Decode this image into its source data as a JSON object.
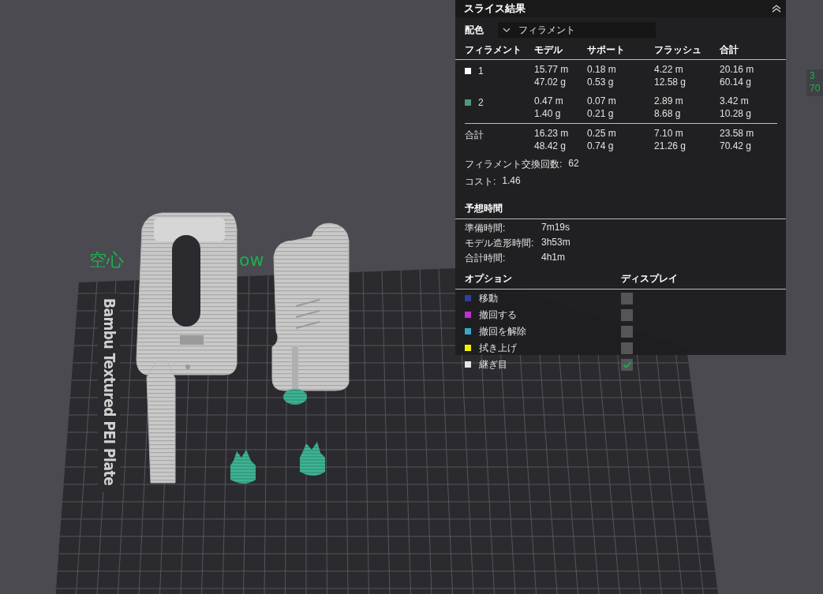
{
  "viewport": {
    "overlay_labels": [
      {
        "text": "空心",
        "kind": "left"
      },
      {
        "text": "ow",
        "kind": "right"
      }
    ],
    "plate_name": "Bambu Textured PEI Plate",
    "side_readout": [
      "3",
      "70"
    ]
  },
  "slice_panel": {
    "title": "スライス結果",
    "color_scheme": {
      "label": "配色",
      "value": "フィラメント"
    },
    "filament_table": {
      "columns": [
        "フィラメント",
        "モデル",
        "サポート",
        "フラッシュ",
        "合計"
      ],
      "rows": [
        {
          "color": "#ffffff",
          "cells": [
            "1",
            "15.77 m\n47.02 g",
            "0.18 m\n0.53 g",
            "4.22 m\n12.58 g",
            "20.16 m\n60.14 g"
          ]
        },
        {
          "color": "#4e9a7c",
          "cells": [
            "2",
            "0.47 m\n1.40 g",
            "0.07 m\n0.21 g",
            "2.89 m\n8.68 g",
            "3.42 m\n10.28 g"
          ]
        }
      ],
      "total": {
        "cells": [
          "合計",
          "16.23 m\n48.42 g",
          "0.25 m\n0.74 g",
          "7.10 m\n21.26 g",
          "23.58 m\n70.42 g"
        ]
      }
    },
    "filament_changes": {
      "label": "フィラメント交換回数:",
      "value": "62"
    },
    "cost": {
      "label": "コスト:",
      "value": "1.46"
    },
    "estimated_time": {
      "title": "予想時間",
      "rows": [
        {
          "label": "準備時間:",
          "value": "7m19s"
        },
        {
          "label": "モデル造形時間:",
          "value": "3h53m"
        },
        {
          "label": "合計時間:",
          "value": "4h1m"
        }
      ]
    },
    "options": {
      "columns": [
        "オプション",
        "ディスプレイ"
      ],
      "items": [
        {
          "label": "移動",
          "color": "#2f3f9c",
          "checked": false
        },
        {
          "label": "撤回する",
          "color": "#c22fd0",
          "checked": false
        },
        {
          "label": "撤回を解除",
          "color": "#3aa8c8",
          "checked": false
        },
        {
          "label": "拭き上げ",
          "color": "#f0f000",
          "checked": false
        },
        {
          "label": "継ぎ目",
          "color": "#e6e6e6",
          "checked": true
        }
      ]
    }
  }
}
